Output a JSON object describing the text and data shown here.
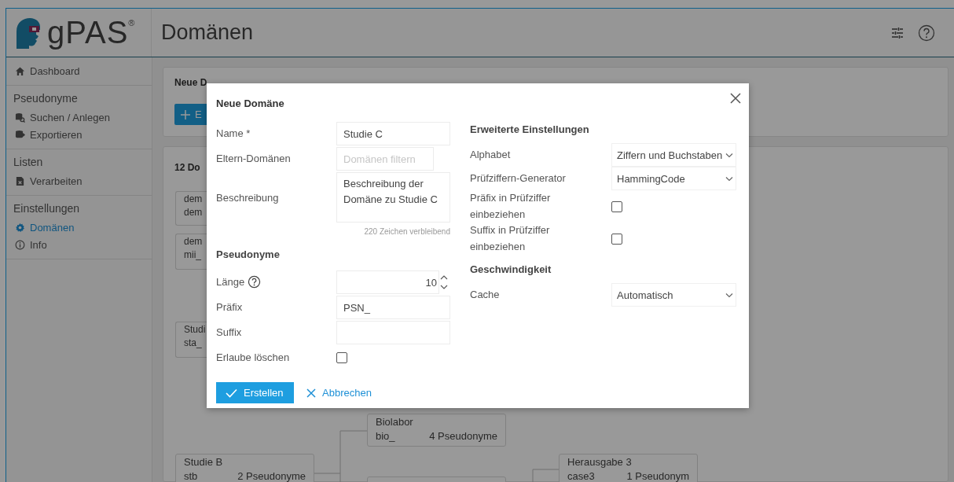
{
  "header": {
    "logo_text": "gPAS",
    "registered_mark": "®",
    "title": "Domänen"
  },
  "sidebar": {
    "sections": [
      {
        "items": [
          {
            "label": "Dashboard",
            "selected": false
          }
        ]
      },
      {
        "heading": "Pseudonyme",
        "items": [
          {
            "label": "Suchen / Anlegen",
            "selected": false
          },
          {
            "label": "Exportieren",
            "selected": false
          }
        ]
      },
      {
        "heading": "Listen",
        "items": [
          {
            "label": "Verarbeiten",
            "selected": false
          }
        ]
      },
      {
        "heading": "Einstellungen",
        "items": [
          {
            "label": "Domänen",
            "selected": true
          },
          {
            "label": "Info",
            "selected": false
          }
        ]
      }
    ]
  },
  "new_domain_card": {
    "heading": "Neue D",
    "button_label": "E"
  },
  "domains_card": {
    "heading": "12 Do",
    "nodes": [
      {
        "title": "dem",
        "code": "dem"
      },
      {
        "title": "dem",
        "code": "mii_"
      },
      {
        "title": "Studi",
        "code": "sta_"
      },
      {
        "title": "Biolabor",
        "code": "bio_",
        "count": "4 Pseudonyme"
      },
      {
        "title": "Studie B",
        "code": "stb",
        "count": "2 Pseudonyme"
      },
      {
        "title": "Herausgabe 3",
        "code": "case3",
        "count": "1 Pseudonym"
      }
    ]
  },
  "dialog": {
    "title": "Neue Domäne",
    "left_fields": [
      {
        "kind": "text",
        "label": "Name *",
        "value": "Studie C"
      },
      {
        "kind": "filter",
        "label": "Eltern-Domänen",
        "placeholder": "Domänen filtern"
      },
      {
        "kind": "textarea",
        "label": "Beschreibung",
        "value": "Beschreibung der Domäne zu Studie C",
        "hint": "220 Zeichen verbleibend"
      },
      {
        "kind": "heading",
        "label": "Pseudonyme"
      },
      {
        "kind": "number",
        "label": "Länge",
        "value": "10",
        "help": true
      },
      {
        "kind": "text",
        "label": "Präfix",
        "value": "PSN_"
      },
      {
        "kind": "text",
        "label": "Suffix"
      },
      {
        "kind": "checkbox",
        "label": "Erlaube löschen",
        "checked": false
      }
    ],
    "right_fields": [
      {
        "kind": "heading",
        "label": "Erweiterte Einstellungen"
      },
      {
        "kind": "select",
        "label": "Alphabet",
        "value": "Ziffern und Buchstaben"
      },
      {
        "kind": "select",
        "label": "Prüfziffern-Generator",
        "value": "HammingCode"
      },
      {
        "kind": "checkbox",
        "label": "Präfix in Prüfziffer einbeziehen",
        "checked": false
      },
      {
        "kind": "checkbox",
        "label": "Suffix in Prüfziffer einbeziehen",
        "checked": false
      },
      {
        "kind": "heading",
        "label": "Geschwindigkeit"
      },
      {
        "kind": "select",
        "label": "Cache",
        "value": "Automatisch"
      }
    ],
    "submit_label": "Erstellen",
    "cancel_label": "Abbrechen"
  }
}
